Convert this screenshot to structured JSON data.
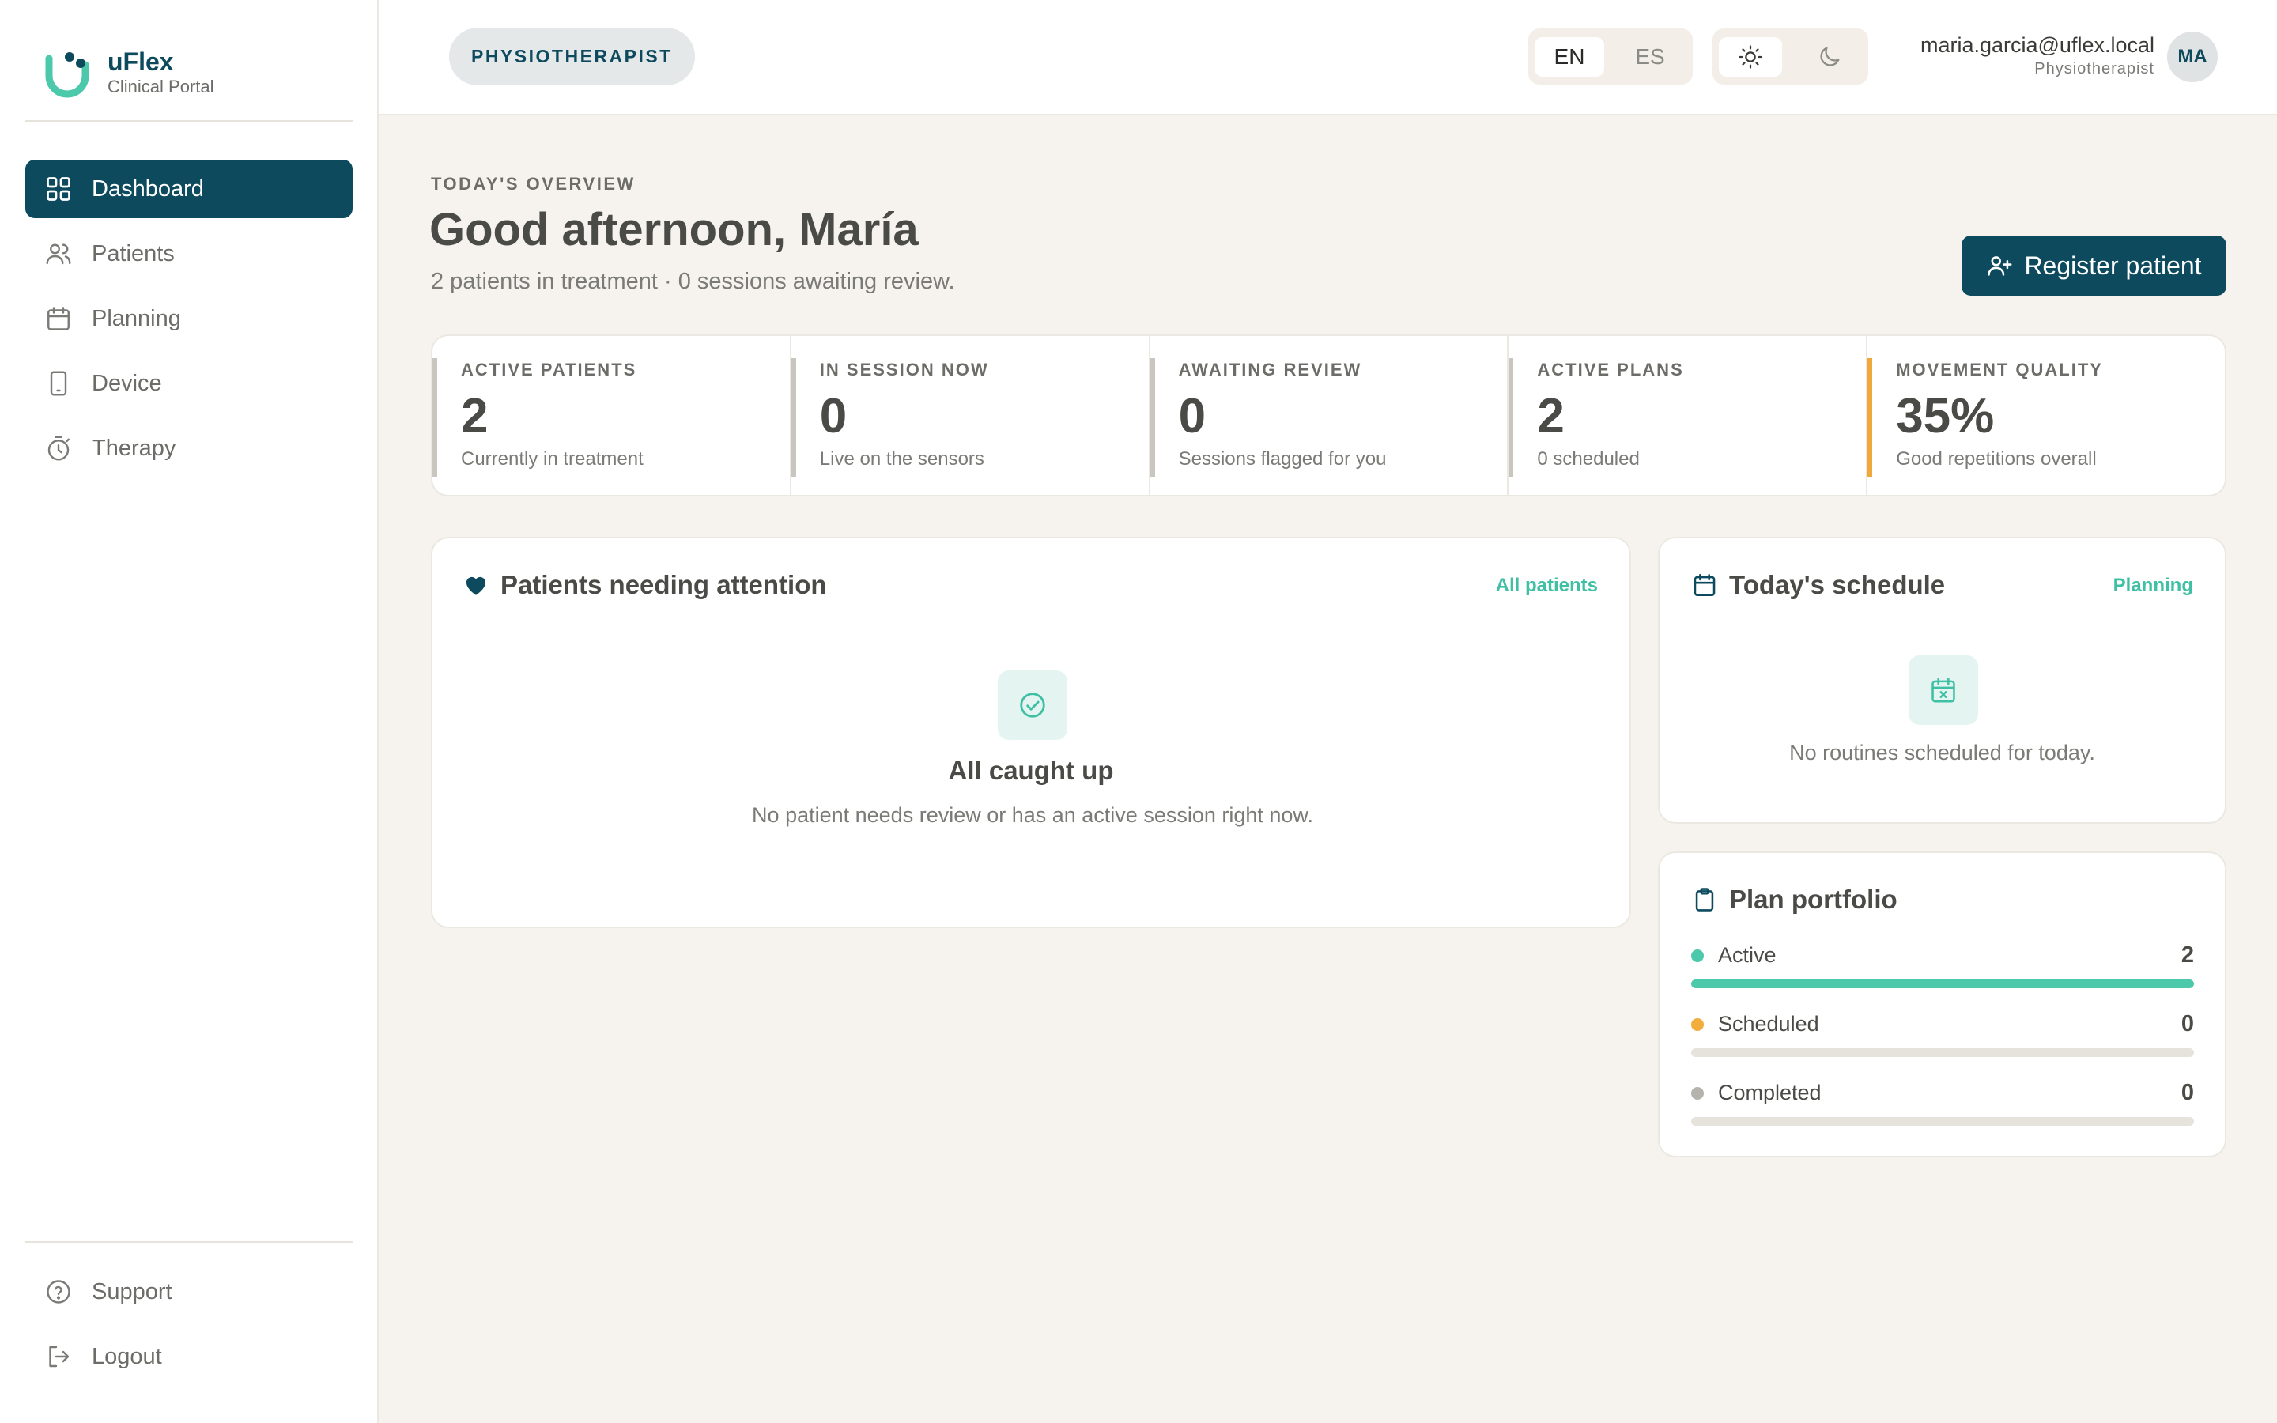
{
  "brand": {
    "name": "uFlex",
    "subtitle": "Clinical Portal"
  },
  "sidebar": {
    "items": [
      {
        "label": "Dashboard",
        "icon": "dashboard-grid-icon",
        "active": true
      },
      {
        "label": "Patients",
        "icon": "users-icon",
        "active": false
      },
      {
        "label": "Planning",
        "icon": "calendar-icon",
        "active": false
      },
      {
        "label": "Device",
        "icon": "smartphone-icon",
        "active": false
      },
      {
        "label": "Therapy",
        "icon": "timer-icon",
        "active": false
      }
    ],
    "bottom": [
      {
        "label": "Support",
        "icon": "help-circle-icon"
      },
      {
        "label": "Logout",
        "icon": "logout-icon"
      }
    ]
  },
  "topbar": {
    "role": "PHYSIOTHERAPIST",
    "languages": [
      "EN",
      "ES"
    ],
    "active_language": "EN",
    "theme": "light",
    "user": {
      "email": "maria.garcia@uflex.local",
      "role": "Physiotherapist",
      "initials": "MA"
    }
  },
  "header": {
    "eyebrow": "TODAY'S OVERVIEW",
    "greeting": "Good afternoon, María",
    "summary": "2 patients in treatment · 0 sessions awaiting review.",
    "register_label": "Register patient"
  },
  "stats": [
    {
      "label": "ACTIVE PATIENTS",
      "value": "2",
      "desc": "Currently in treatment",
      "accent": "#c9c6bf"
    },
    {
      "label": "IN SESSION NOW",
      "value": "0",
      "desc": "Live on the sensors",
      "accent": "#c9c6bf"
    },
    {
      "label": "AWAITING REVIEW",
      "value": "0",
      "desc": "Sessions flagged for you",
      "accent": "#c9c6bf"
    },
    {
      "label": "ACTIVE PLANS",
      "value": "2",
      "desc": "0 scheduled",
      "accent": "#c9c6bf"
    },
    {
      "label": "MOVEMENT QUALITY",
      "value": "35%",
      "desc": "Good repetitions overall",
      "accent": "#f0a83a"
    }
  ],
  "attention": {
    "title": "Patients needing attention",
    "link": "All patients",
    "empty_title": "All caught up",
    "empty_text": "No patient needs review or has an active session right now."
  },
  "schedule": {
    "title": "Today's schedule",
    "link": "Planning",
    "empty_text": "No routines scheduled for today."
  },
  "portfolio": {
    "title": "Plan portfolio",
    "rows": [
      {
        "label": "Active",
        "count": "2",
        "color": "#4cc8ab",
        "fill_fraction": 1.0
      },
      {
        "label": "Scheduled",
        "count": "0",
        "color": "#f2ad3d",
        "fill_fraction": 0.0
      },
      {
        "label": "Completed",
        "count": "0",
        "color": "#b5b3ae",
        "fill_fraction": 0.0
      }
    ]
  },
  "colors": {
    "primary": "#0d4a5e",
    "accent": "#3fbfa3",
    "background": "#f6f3ee"
  }
}
